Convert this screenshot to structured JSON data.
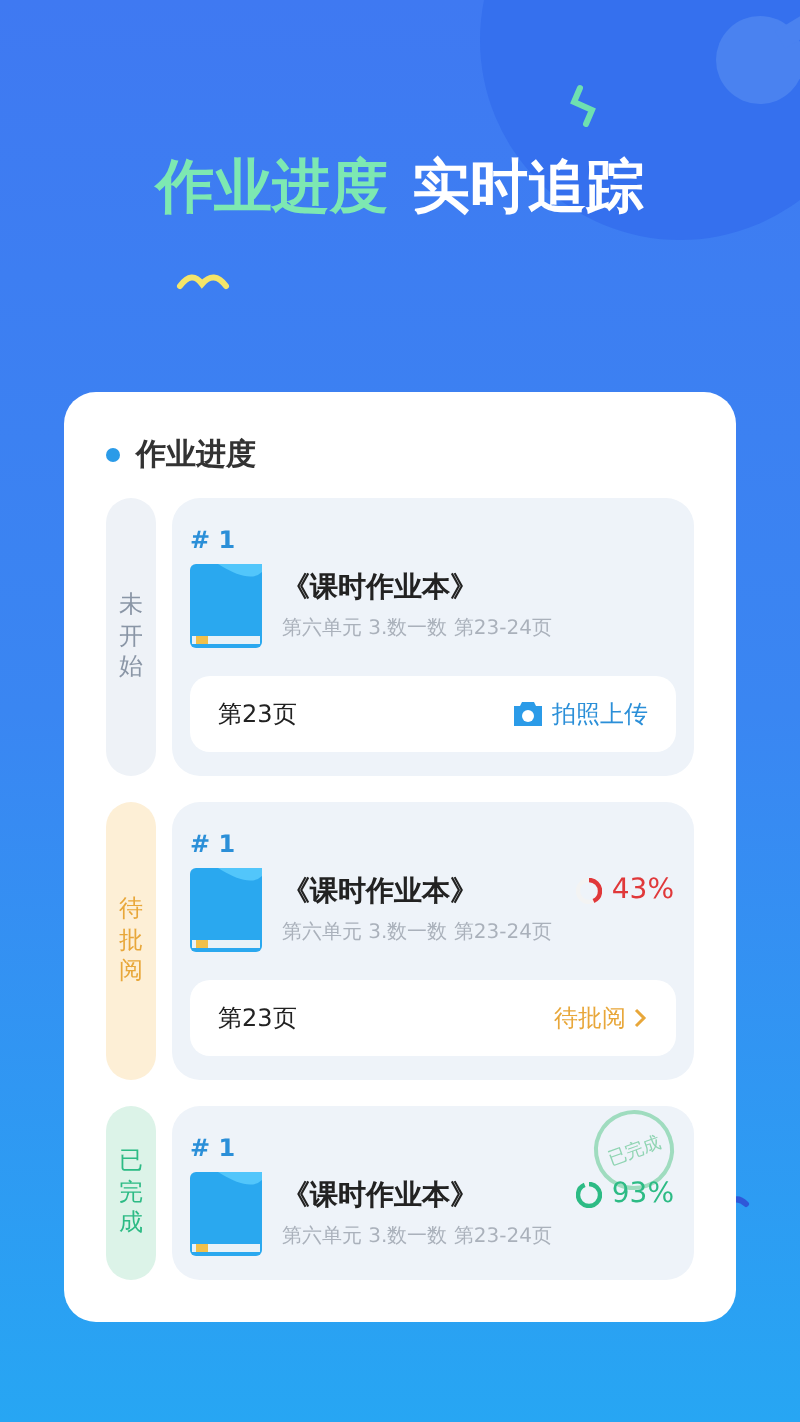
{
  "headline": {
    "highlight": "作业进度",
    "rest": "实时追踪"
  },
  "panel": {
    "title": "作业进度",
    "groups": [
      {
        "status": "未开始",
        "kind": "not_started",
        "items": [
          {
            "number": "# 1",
            "title": "《课时作业本》",
            "subtitle": "第六单元 3.数一数 第23-24页",
            "footer": {
              "page": "第23页",
              "action": "拍照上传",
              "kind": "upload"
            }
          }
        ]
      },
      {
        "status": "待批阅",
        "kind": "pending",
        "items": [
          {
            "number": "# 1",
            "title": "《课时作业本》",
            "subtitle": "第六单元 3.数一数 第23-24页",
            "progress": {
              "level": 0.43,
              "reading": "43%"
            },
            "footer": {
              "page": "第23页",
              "action": "待批阅",
              "kind": "review"
            }
          }
        ]
      },
      {
        "status": "已完成",
        "kind": "done",
        "items": [
          {
            "number": "# 1",
            "title": "《课时作业本》",
            "subtitle": "第六单元 3.数一数 第23-24页",
            "stamp": "已完成",
            "progress": {
              "level": 0.93,
              "reading": "93%"
            }
          }
        ]
      }
    ]
  }
}
